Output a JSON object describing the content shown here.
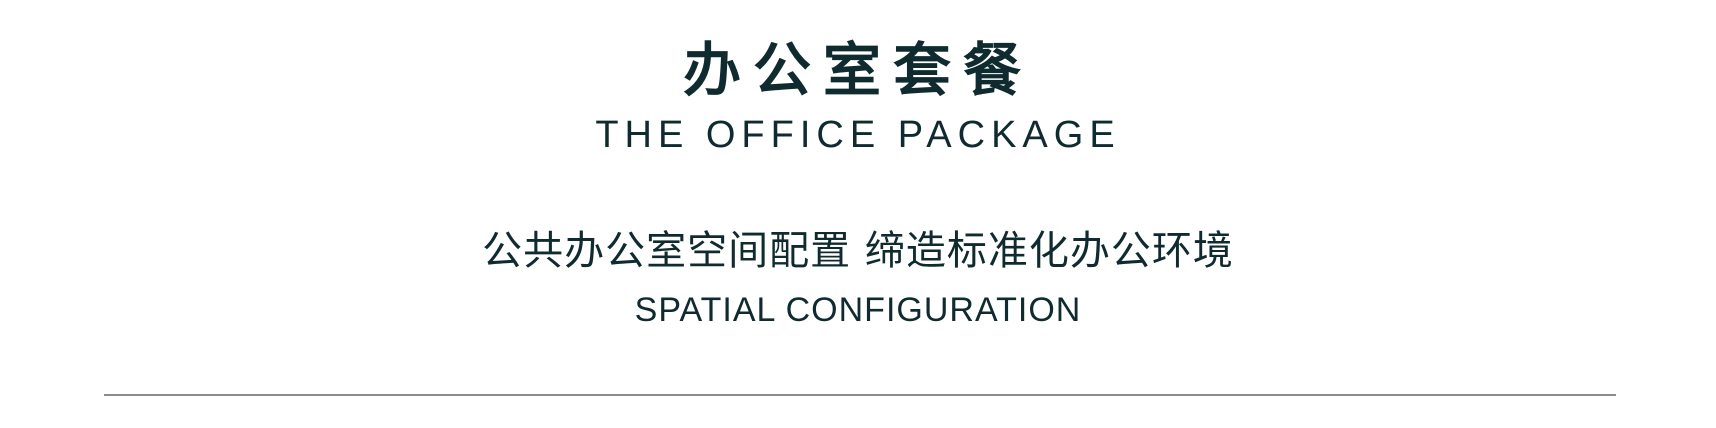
{
  "header": {
    "title_cn": "办公室套餐",
    "title_en": "THE OFFICE PACKAGE"
  },
  "subheader": {
    "line_cn": "公共办公室空间配置 缔造标准化办公环境",
    "line_en": "SPATIAL CONFIGURATION"
  },
  "colors": {
    "text": "#0f2b2f",
    "divider": "#8c8c8c",
    "background": "#ffffff"
  }
}
